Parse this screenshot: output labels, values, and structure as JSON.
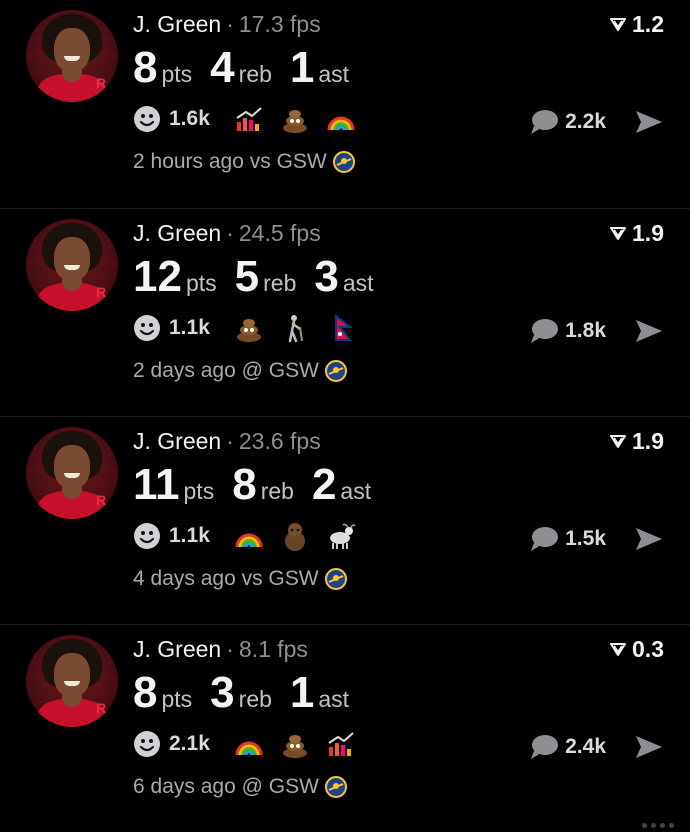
{
  "posts": [
    {
      "player": "J. Green",
      "fps": "17.3 fps",
      "score": "1.2",
      "stats": [
        {
          "value": "8",
          "unit": "pts"
        },
        {
          "value": "4",
          "unit": "reb"
        },
        {
          "value": "1",
          "unit": "ast"
        }
      ],
      "reaction_count": "1.6k",
      "emojis": [
        "chart-down-icon",
        "poop-icon",
        "rainbow-icon"
      ],
      "comment_count": "2.2k",
      "time": "2 hours ago vs GSW"
    },
    {
      "player": "J. Green",
      "fps": "24.5 fps",
      "score": "1.9",
      "stats": [
        {
          "value": "12",
          "unit": "pts"
        },
        {
          "value": "5",
          "unit": "reb"
        },
        {
          "value": "3",
          "unit": "ast"
        }
      ],
      "reaction_count": "1.1k",
      "emojis": [
        "poop-icon",
        "elderly-person-icon",
        "nepal-flag-icon"
      ],
      "comment_count": "1.8k",
      "time": "2 days ago @ GSW"
    },
    {
      "player": "J. Green",
      "fps": "23.6 fps",
      "score": "1.9",
      "stats": [
        {
          "value": "11",
          "unit": "pts"
        },
        {
          "value": "8",
          "unit": "reb"
        },
        {
          "value": "2",
          "unit": "ast"
        }
      ],
      "reaction_count": "1.1k",
      "emojis": [
        "rainbow-icon",
        "chewbacca-icon",
        "goat-icon"
      ],
      "comment_count": "1.5k",
      "time": "4 days ago vs GSW"
    },
    {
      "player": "J. Green",
      "fps": "8.1 fps",
      "score": "0.3",
      "stats": [
        {
          "value": "8",
          "unit": "pts"
        },
        {
          "value": "3",
          "unit": "reb"
        },
        {
          "value": "1",
          "unit": "ast"
        }
      ],
      "reaction_count": "2.1k",
      "emojis": [
        "rainbow-icon",
        "poop-icon",
        "chart-down-icon"
      ],
      "comment_count": "2.4k",
      "time": "6 days ago @ GSW"
    }
  ],
  "colors": {
    "background": "#000000",
    "muted_text": "#8e8e93",
    "team_red": "#c8102e",
    "warriors_blue": "#1d428a",
    "warriors_gold": "#ffc72c"
  }
}
